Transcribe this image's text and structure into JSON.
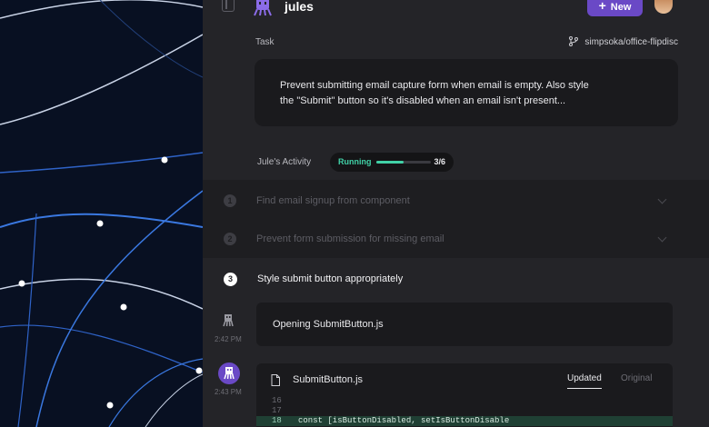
{
  "header": {
    "app_name": "jules",
    "new_button": "New",
    "sidebar_toggle_icon": "sidebar-toggle-icon",
    "logo_icon": "octopus-logo-icon"
  },
  "task": {
    "label": "Task",
    "repo": "simpsoka/office-flipdisc",
    "description_line1": "Prevent submitting email capture form when email is empty. Also style",
    "description_line2": "the \"Submit\" button so it's disabled when an email isn't present..."
  },
  "activity": {
    "label": "Jule's Activity",
    "status": "Running",
    "progress": "3/6",
    "progress_fraction": 0.5,
    "accent": "#41d1a7"
  },
  "steps": [
    {
      "num": "1",
      "label": "Find email signup from component"
    },
    {
      "num": "2",
      "label": "Prevent form submission for missing email"
    },
    {
      "num": "3",
      "label": "Style submit button appropriately"
    }
  ],
  "messages": [
    {
      "time": "2:42 PM",
      "text": "Opening SubmitButton.js"
    },
    {
      "time": "2:43 PM"
    }
  ],
  "code": {
    "file_name": "SubmitButton.js",
    "tab_updated": "Updated",
    "tab_original": "Original",
    "lines": [
      {
        "n": "16",
        "code": ""
      },
      {
        "n": "17",
        "code": ""
      },
      {
        "n": "18",
        "code": "const [isButtonDisabled, setIsButtonDisable"
      }
    ]
  },
  "colors": {
    "brand": "#6a49c6",
    "panel": "#242428",
    "card": "#1a1a1d"
  }
}
